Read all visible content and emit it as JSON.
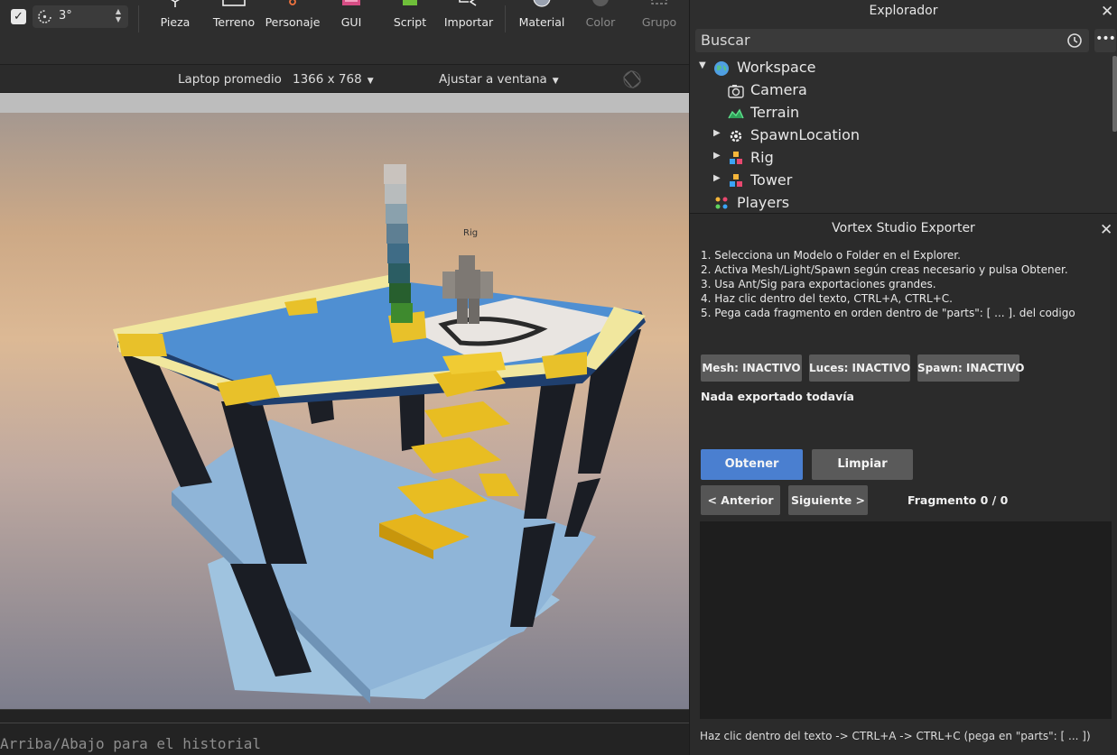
{
  "toolbar": {
    "rotate_value": "3°",
    "buttons": [
      {
        "label": "Pieza",
        "icon": "part-icon",
        "enabled": true
      },
      {
        "label": "Terreno",
        "icon": "terrain-icon",
        "enabled": true
      },
      {
        "label": "Personaje",
        "icon": "character-icon",
        "enabled": true
      },
      {
        "label": "GUI",
        "icon": "gui-icon",
        "enabled": true
      },
      {
        "label": "Script",
        "icon": "script-icon",
        "enabled": true
      },
      {
        "label": "Importar",
        "icon": "import-icon",
        "enabled": true
      },
      {
        "label": "Material",
        "icon": "material-icon",
        "enabled": true
      },
      {
        "label": "Color",
        "icon": "color-icon",
        "enabled": false
      },
      {
        "label": "Grupo",
        "icon": "group-icon",
        "enabled": false
      }
    ]
  },
  "device_bar": {
    "device": "Laptop promedio",
    "resolution": "1366 x 768",
    "fit": "Ajustar a ventana"
  },
  "viewport": {
    "rig_label": "Rig"
  },
  "command_bar": {
    "input_text": "Arriba/Abajo para el historial"
  },
  "explorer": {
    "title": "Explorador",
    "search_placeholder": "Buscar",
    "items": [
      {
        "label": "Workspace",
        "icon": "workspace-globe-icon",
        "expanded": true,
        "depth": 0
      },
      {
        "label": "Camera",
        "icon": "camera-icon",
        "depth": 1
      },
      {
        "label": "Terrain",
        "icon": "terrain-icon",
        "depth": 1
      },
      {
        "label": "SpawnLocation",
        "icon": "spawn-gear-icon",
        "collapsed": true,
        "depth": 1
      },
      {
        "label": "Rig",
        "icon": "model-icon",
        "collapsed": true,
        "depth": 1
      },
      {
        "label": "Tower",
        "icon": "model-icon",
        "collapsed": true,
        "depth": 1
      },
      {
        "label": "Players",
        "icon": "players-icon",
        "depth": 0
      }
    ]
  },
  "exporter": {
    "title": "Vortex Studio Exporter",
    "instructions": [
      "1. Selecciona un Modelo o Folder en el Explorer.",
      "2. Activa Mesh/Light/Spawn según creas necesario y pulsa Obtener.",
      "3. Usa Ant/Sig para exportaciones grandes.",
      "4. Haz clic dentro del texto, CTRL+A, CTRL+C.",
      "5. Pega cada fragmento en orden dentro de \"parts\": [ ... ]. del codigo"
    ],
    "toggles": {
      "mesh": "Mesh: INACTIVO",
      "lights": "Luces: INACTIVO",
      "spawn": "Spawn: INACTIVO"
    },
    "status": "Nada exportado todavía",
    "get_label": "Obtener",
    "clear_label": "Limpiar",
    "prev_label": "< Anterior",
    "next_label": "Siguiente >",
    "fragment": "Fragmento 0 / 0",
    "output_text": "",
    "hint": "Haz clic dentro del texto -> CTRL+A -> CTRL+C (pega en \"parts\": [ ... ])",
    "colors": {
      "primary": "#4a7fd0",
      "secondary": "#5a5a5a"
    }
  }
}
